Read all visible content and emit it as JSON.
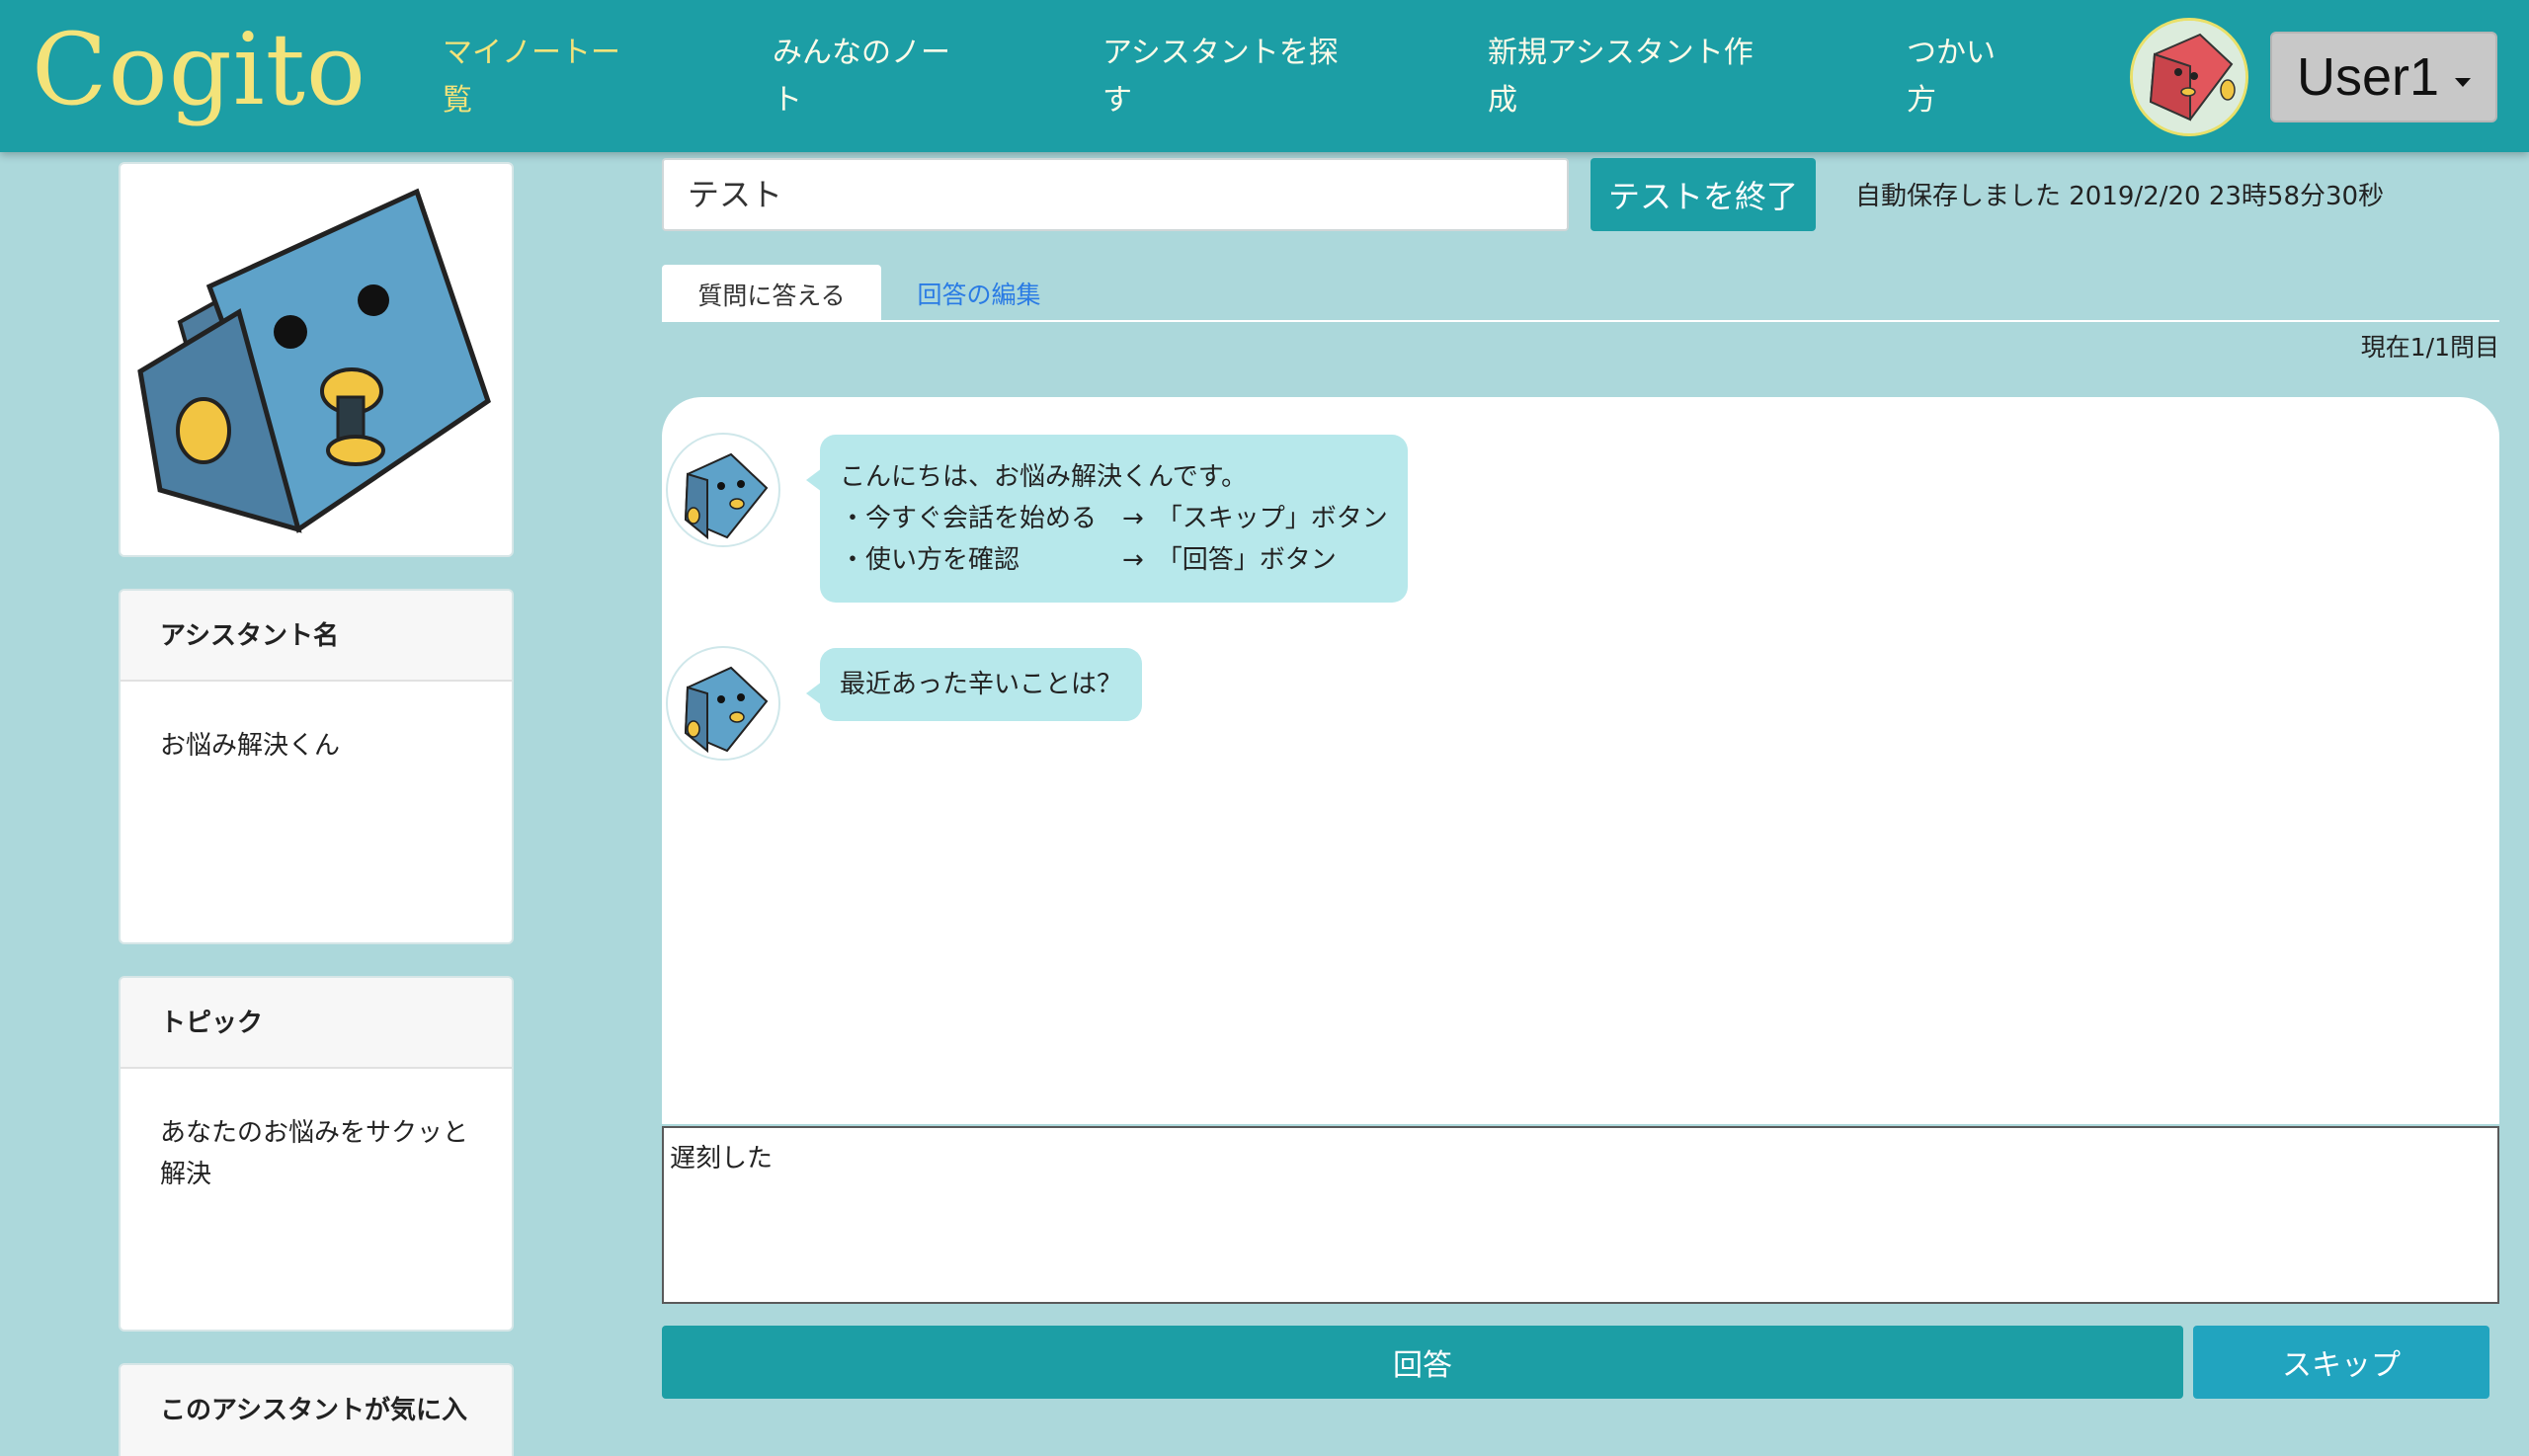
{
  "app": {
    "brand": "Cogito"
  },
  "nav": {
    "items": [
      {
        "line1": "マイノートー",
        "line2": "覧"
      },
      {
        "line1": "みんなのノー",
        "line2": "ト"
      },
      {
        "line1": "アシスタントを探",
        "line2": "す"
      },
      {
        "line1": "新規アシスタント作",
        "line2": "成"
      },
      {
        "line1": "つかい",
        "line2": "方"
      }
    ],
    "user_label": "User1"
  },
  "sidebar": {
    "assistant_name_header": "アシスタント名",
    "assistant_name": "お悩み解決くん",
    "topic_header": "トピック",
    "topic_line1": "あなたのお悩みをサクッと",
    "topic_line2": "解決",
    "favorite_header": "このアシスタントが気に入"
  },
  "main": {
    "title_value": "テスト",
    "end_test_label": "テストを終了",
    "autosave_text": "自動保存しました 2019/2/20 23時58分30秒",
    "tabs": [
      {
        "label": "質問に答える"
      },
      {
        "label": "回答の編集"
      }
    ],
    "progress_text": "現在1/1問目",
    "messages": [
      {
        "lines": [
          "こんにちは、お悩み解決くんです。",
          "・今すぐ会話を始める　→　「スキップ」ボタン",
          "・使い方を確認　　　　→　「回答」ボタン"
        ]
      },
      {
        "lines": [
          "最近あった辛いことは？"
        ]
      }
    ],
    "answer_value": "遅刻した",
    "answer_button": "回答",
    "skip_button": "スキップ"
  },
  "colors": {
    "navbar": "#1c9ea5",
    "brand": "#f3e37a",
    "page_bg": "#acd8db",
    "bubble": "#b7e8eb",
    "primary_button": "#1c9ea5",
    "skip_button": "#21a4bf",
    "link": "#2a7be4"
  }
}
